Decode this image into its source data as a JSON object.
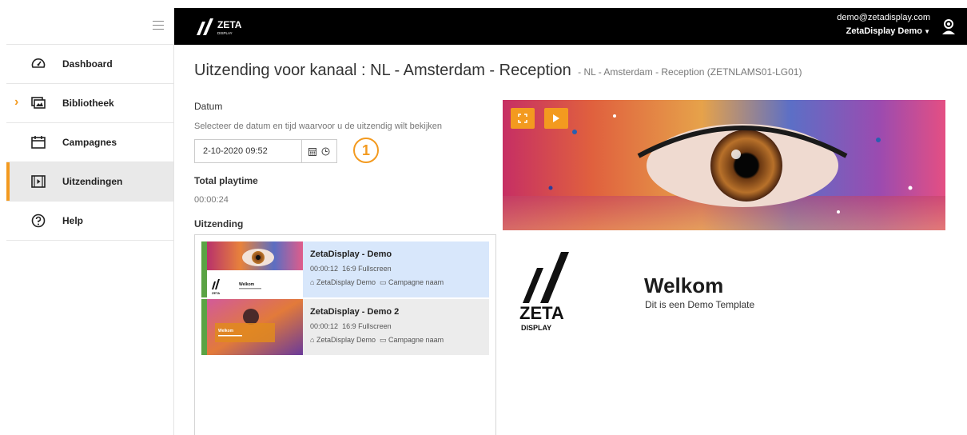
{
  "header": {
    "logo_text": "ZETA",
    "logo_sub": "DISPLAY",
    "user_email": "demo@zetadisplay.com",
    "user_org": "ZetaDisplay Demo"
  },
  "sidebar": {
    "items": [
      {
        "label": "Dashboard",
        "icon": "speedometer-icon"
      },
      {
        "label": "Bibliotheek",
        "icon": "library-icon"
      },
      {
        "label": "Campagnes",
        "icon": "calendar-icon"
      },
      {
        "label": "Uitzendingen",
        "icon": "broadcast-icon",
        "active": true
      },
      {
        "label": "Help",
        "icon": "help-icon"
      }
    ]
  },
  "page": {
    "title": "Uitzending voor kanaal : NL - Amsterdam - Reception",
    "subtitle": "- NL - Amsterdam - Reception (ZETNLAMS01-LG01)"
  },
  "datum": {
    "label": "Datum",
    "help": "Selecteer de datum en tijd waarvoor u de uitzendig wilt bekijken",
    "value": "2-10-2020 09:52",
    "step_badge": "1"
  },
  "playtime": {
    "label": "Total playtime",
    "value": "00:00:24"
  },
  "uitzending": {
    "label": "Uitzending",
    "items": [
      {
        "title": "ZetaDisplay - Demo",
        "duration": "00:00:12",
        "format": "16:9 Fullscreen",
        "site": "ZetaDisplay Demo",
        "campaign": "Campagne naam",
        "selected": true
      },
      {
        "title": "ZetaDisplay - Demo 2",
        "duration": "00:00:12",
        "format": "16:9 Fullscreen",
        "site": "ZetaDisplay Demo",
        "campaign": "Campagne naam",
        "selected": false
      }
    ]
  },
  "preview": {
    "logo_text": "ZETA",
    "logo_sub": "DISPLAY",
    "welcome_title": "Welkom",
    "welcome_sub": "Dit is een Demo Template"
  },
  "colors": {
    "accent": "#f39a1f",
    "green_bar": "#5aa344",
    "selected_bg": "#d8e7fb",
    "item_bg": "#ececec",
    "header_bg": "#000000"
  }
}
